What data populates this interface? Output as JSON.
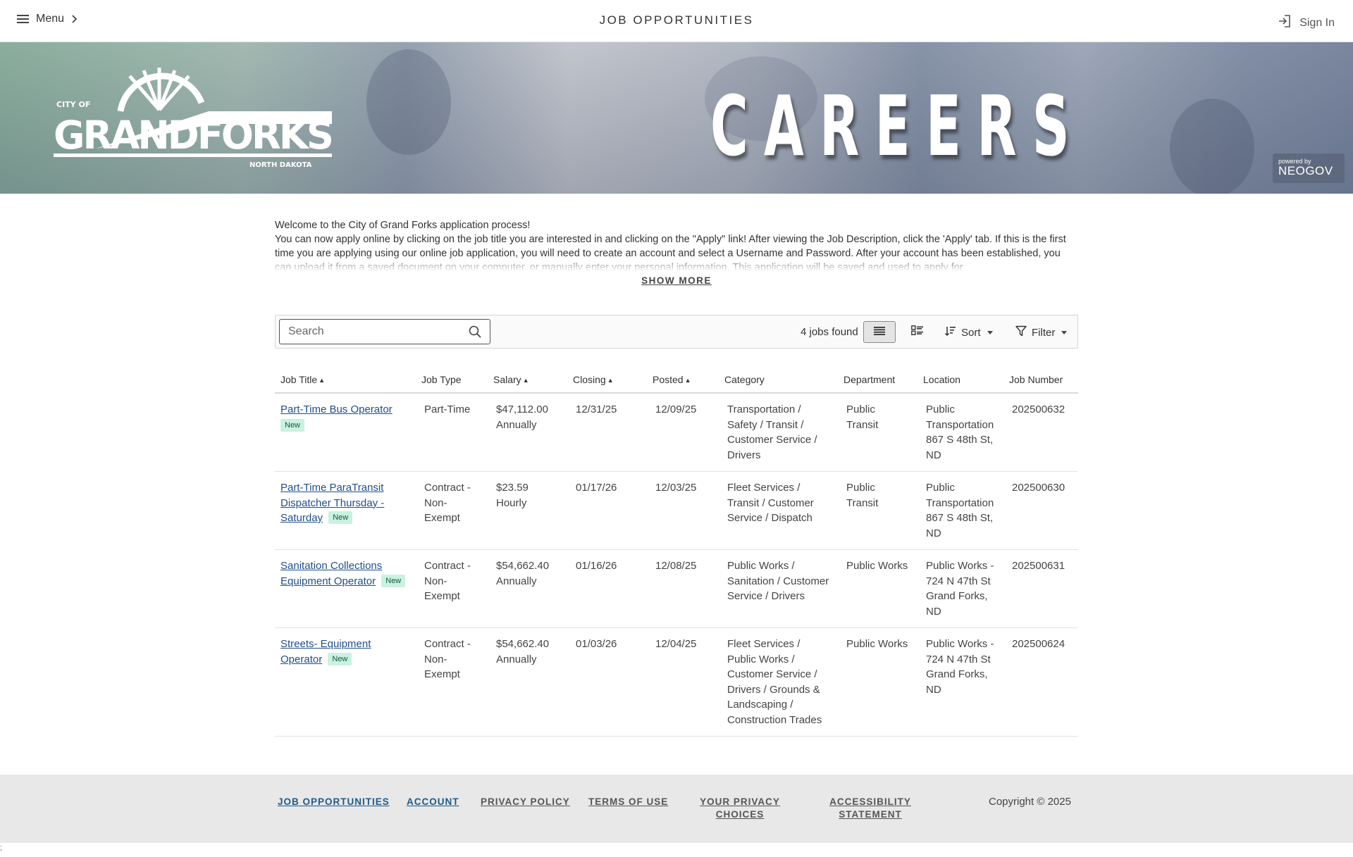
{
  "header": {
    "menu_label": "Menu",
    "page_title": "JOB OPPORTUNITIES",
    "signin_label": "Sign In"
  },
  "banner": {
    "logo_top": "CITY OF",
    "logo_main": "GRANDFORKS",
    "logo_sub": "NORTH DAKOTA",
    "headline": "CAREERS",
    "neogov_small": "powered by",
    "neogov_big": "NEOGOV"
  },
  "welcome": {
    "line1": "Welcome to the City of Grand Forks application process!",
    "line2": "You can now apply online by clicking on the job title you are interested in and clicking on the \"Apply\" link! After viewing the Job Description, click the 'Apply' tab. If this is the first time you are applying using our online job application, you will need to create an account and select a Username and Password. After your account has been established, you can upload it from a saved document on your computer, or manually enter your personal information. This application will be saved and used to apply for",
    "show_more": "SHOW MORE"
  },
  "toolbar": {
    "search_placeholder": "Search",
    "jobs_found": "4 jobs found",
    "sort_label": "Sort",
    "filter_label": "Filter"
  },
  "table": {
    "headers": [
      "Job Title",
      "Job Type",
      "Salary",
      "Closing",
      "Posted",
      "Category",
      "Department",
      "Location",
      "Job Number"
    ],
    "rows": [
      {
        "title": "Part-Time Bus Operator",
        "badge": "New",
        "type": "Part-Time",
        "salary_amount": "$47,112.00",
        "salary_period": "Annually",
        "closing": "12/31/25",
        "posted": "12/09/25",
        "category": "Transportation / Safety / Transit / Customer Service / Drivers",
        "department": "Public Transit",
        "location": "Public Transportation 867 S 48th St, ND",
        "job_number": "202500632"
      },
      {
        "title": "Part-Time ParaTransit Dispatcher Thursday - Saturday",
        "badge": "New",
        "type": "Contract - Non-Exempt",
        "salary_amount": "$23.59",
        "salary_period": "Hourly",
        "closing": "01/17/26",
        "posted": "12/03/25",
        "category": "Fleet Services / Transit / Customer Service / Dispatch",
        "department": "Public Transit",
        "location": "Public Transportation 867 S 48th St, ND",
        "job_number": "202500630"
      },
      {
        "title": "Sanitation Collections Equipment Operator",
        "badge": "New",
        "type": "Contract - Non-Exempt",
        "salary_amount": "$54,662.40",
        "salary_period": "Annually",
        "closing": "01/16/26",
        "posted": "12/08/25",
        "category": "Public Works / Sanitation / Customer Service / Drivers",
        "department": "Public Works",
        "location": "Public Works - 724 N 47th St Grand Forks, ND",
        "job_number": "202500631"
      },
      {
        "title": "Streets- Equipment Operator",
        "badge": "New",
        "type": "Contract - Non-Exempt",
        "salary_amount": "$54,662.40",
        "salary_period": "Annually",
        "closing": "01/03/26",
        "posted": "12/04/25",
        "category": "Fleet Services / Public Works / Customer Service / Drivers / Grounds & Landscaping / Construction Trades",
        "department": "Public Works",
        "location": "Public Works - 724 N 47th St Grand Forks, ND",
        "job_number": "202500624"
      }
    ]
  },
  "footer": {
    "links": [
      "JOB OPPORTUNITIES",
      "ACCOUNT",
      "PRIVACY POLICY",
      "TERMS OF USE",
      "YOUR PRIVACY CHOICES",
      "ACCESSIBILITY STATEMENT"
    ],
    "copyright": "Copyright © 2025",
    "stray_mark": ";"
  },
  "colors": {
    "link": "#1f4e8c",
    "badge_bg": "#c9f2e0",
    "footer_bg": "#e8e8e8"
  },
  "icons": [
    "menu-icon",
    "chevron-right-icon",
    "sign-in-icon",
    "search-icon",
    "list-view-icon",
    "card-view-icon",
    "sort-icon",
    "filter-icon"
  ]
}
